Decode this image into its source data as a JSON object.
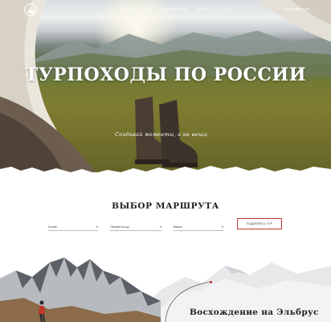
{
  "header": {
    "nav": [
      "Главная",
      "Туры",
      "О путешествиях",
      "Контакты",
      "О нас"
    ],
    "phone": "+7 (916) 961-2173"
  },
  "hero": {
    "title": "ТУРПОХОДЫ ПО РОССИИ",
    "script": "Создавай моменты, а не вещи"
  },
  "route_selector": {
    "title": "ВЫБОР МАРШРУТА",
    "fields": [
      {
        "value": "Алтай"
      },
      {
        "value": "Пеший поход"
      },
      {
        "value": "Вверх"
      }
    ],
    "submit_label": "ПОДОБРАТЬ ТУР"
  },
  "elbrus": {
    "title": "Восхождение на Эльбрус"
  },
  "colors": {
    "accent": "#c0392b",
    "text": "#222222"
  }
}
